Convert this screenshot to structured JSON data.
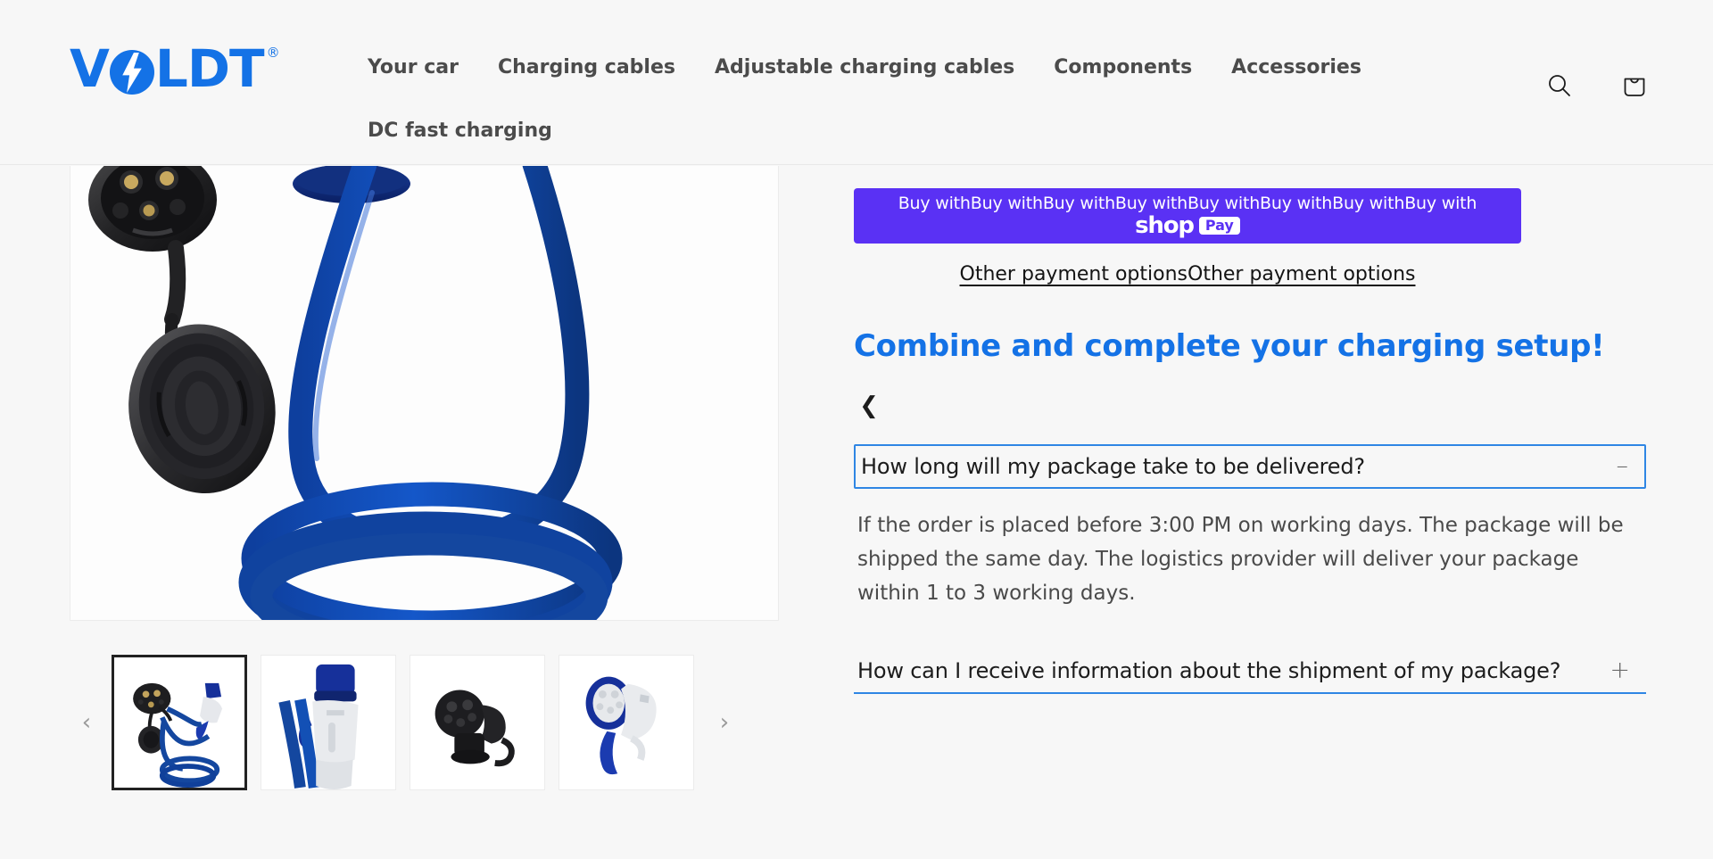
{
  "brand": {
    "name_part1": "V",
    "name_part2": "LDT",
    "registered_mark": "®",
    "logo_color": "#1472e6"
  },
  "header": {
    "nav_items": [
      {
        "label": "Your car",
        "name": "your-car"
      },
      {
        "label": "Charging cables",
        "name": "charging-cables"
      },
      {
        "label": "Adjustable charging cables",
        "name": "adjustable-charging-cables"
      },
      {
        "label": "Components",
        "name": "components"
      },
      {
        "label": "Accessories",
        "name": "accessories"
      },
      {
        "label": "DC fast charging",
        "name": "dc-fast-charging"
      }
    ],
    "search_icon": "search-icon",
    "cart_icon": "shopping-bag-icon"
  },
  "gallery": {
    "prev_arrow": "‹",
    "next_arrow": "›",
    "selected_thumb_index": 0,
    "thumbnails": [
      {
        "alt": "Blue Type 2 charging cable with black and blue connectors",
        "selected": true
      },
      {
        "alt": "Close-up of blue and white Type 2 connector with cable"
      },
      {
        "alt": "Black Type 2 connector with protective cap"
      },
      {
        "alt": "Blue and white Type 2 connector front view"
      }
    ]
  },
  "purchase": {
    "shop_pay_label": "Buy withBuy withBuy withBuy withBuy withBuy withBuy withBuy with",
    "shop_pay_brand": "shop",
    "shop_pay_badge": "Pay",
    "shop_pay_color": "#5a31f4",
    "other_payment_options": "Other payment optionsOther payment options"
  },
  "combine": {
    "heading": "Combine and complete your charging setup!",
    "prev_arrow": "❮",
    "heading_color": "#1472e6"
  },
  "faq": {
    "items": [
      {
        "question": "How long will my package take to be delivered?",
        "answer": "If the order is placed before 3:00 PM on working days. The package will be shipped the same day. The logistics provider will deliver your package within 1 to 3 working days.",
        "state": "open",
        "toggle_glyph": "–"
      },
      {
        "question": "How can I receive information about the shipment of my package?",
        "answer": "",
        "state": "closed",
        "toggle_glyph": "+"
      }
    ],
    "accent_color": "#2f86e4"
  },
  "colors": {
    "page_background": "#f7f7f7",
    "nav_text": "#4b4b4b",
    "body_text": "#4a4a4a",
    "accent_blue": "#1472e6"
  }
}
